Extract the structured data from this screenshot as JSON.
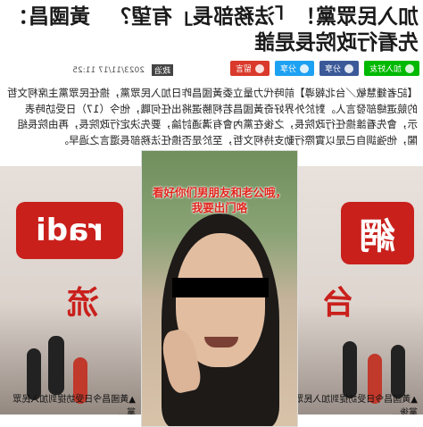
{
  "article": {
    "title": "加入民眾黨！「法務部長」有望？　黃國昌：先看行政院長是誰",
    "date": "2023/11/17 11:25",
    "category": "政治",
    "body": "【記者鍾慧敏／台北報導】前時代力量立委黃國昌昨日加入民眾黨，擔任民眾黨主席柯文哲的競選總部發言人。對於外界好奇黃國昌若柯勝選將出任何職，他今（17）日受訪時表示，會先看誰擔任行政院長，之後在黨內會有溝通討論，要先決定行政院長，再由院長組閣，他強調自己是以實際行動支持柯文哲，至於是否擔任法務部長還言之過早。"
  },
  "share": {
    "buttons": [
      {
        "label": "加入好友",
        "color": "#00b900"
      },
      {
        "label": "分享",
        "color": "#3b5998"
      },
      {
        "label": "分享",
        "color": "#1da1f2"
      },
      {
        "label": "留言",
        "color": "#d93a2b"
      }
    ]
  },
  "photos": {
    "center_overlay": "看好你们男朋友和老公哦，我要出门咯",
    "left_caption": "▲黃國昌今日受訪提到加入民眾黨後...",
    "right_caption": "▲黃國昌今日受訪提到加入民眾黨..."
  },
  "signs": {
    "left_top": "網",
    "left_mid": "台",
    "right_top": "radi",
    "right_mid": "流"
  }
}
